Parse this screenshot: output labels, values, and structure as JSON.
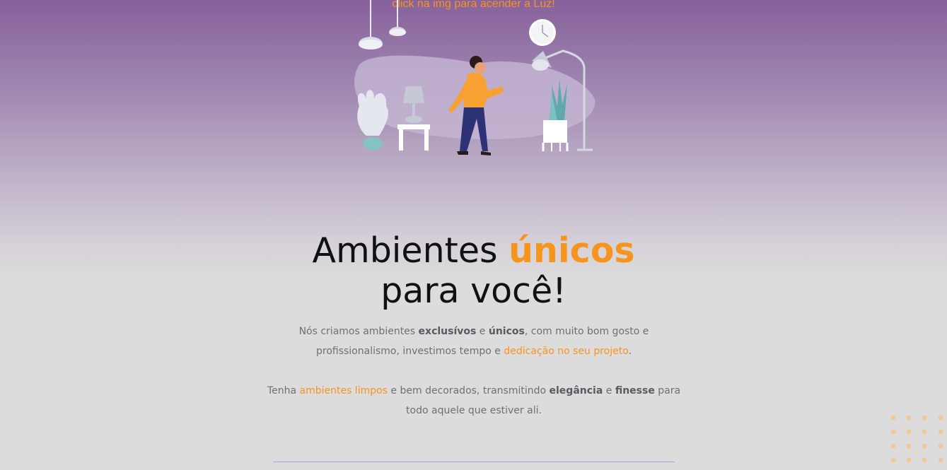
{
  "hint": "click na img para acender a Luz!",
  "headline": {
    "pre": "Ambientes ",
    "accent": "únicos",
    "post": " para você!"
  },
  "paragraph1": {
    "t1": "Nós criamos ambientes ",
    "b1": "exclusívos",
    "t2": " e ",
    "b2": "únicos",
    "t3": ", com muito bom gosto e profissionalismo, investimos tempo e ",
    "hl": "dedicação no seu projeto",
    "t4": "."
  },
  "paragraph2": {
    "t1": "Tenha ",
    "hl": "ambientes limpos",
    "t2": " e bem decorados, transmitindo ",
    "b1": "elegância",
    "t3": " e ",
    "b2": "finesse",
    "t4": " para todo aquele que estiver ali."
  },
  "illustration": {
    "name": "person-turning-on-lamp-illustration"
  },
  "colors": {
    "accent": "#f7941d",
    "purple": "#87619c",
    "divider": "#b79bd6"
  }
}
